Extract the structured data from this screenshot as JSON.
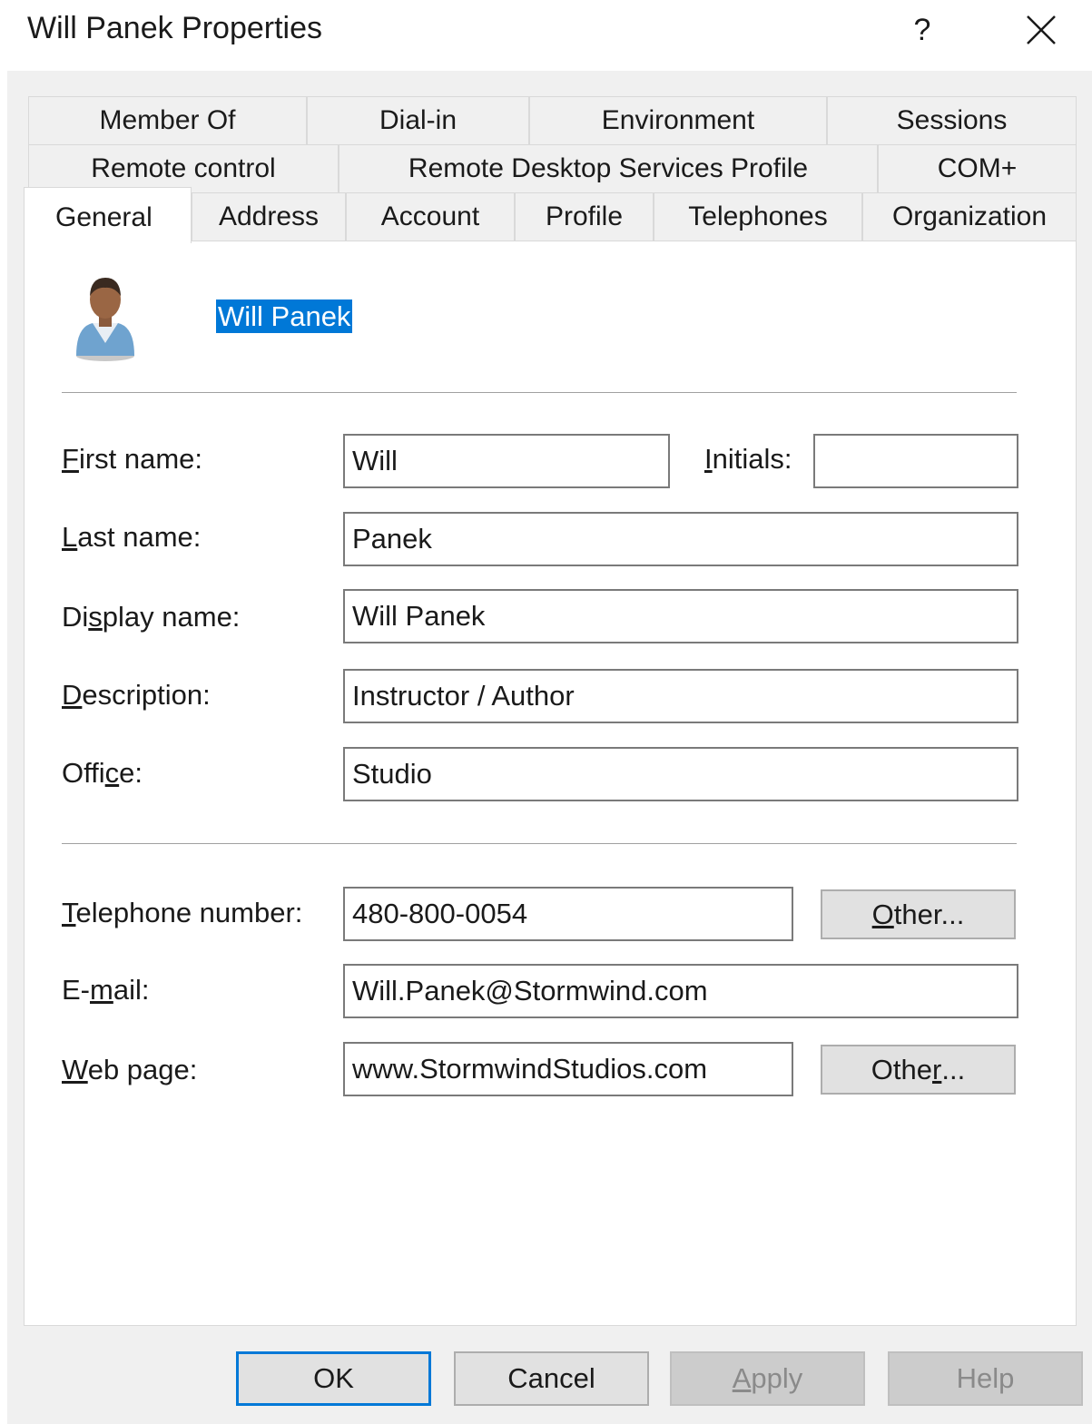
{
  "window": {
    "title": "Will Panek Properties",
    "help_glyph": "?",
    "close_glyph": "✕"
  },
  "tabs": {
    "row1": [
      "Member Of",
      "Dial-in",
      "Environment",
      "Sessions"
    ],
    "row2": [
      "Remote control",
      "Remote Desktop Services Profile",
      "COM+"
    ],
    "row3": [
      "General",
      "Address",
      "Account",
      "Profile",
      "Telephones",
      "Organization"
    ],
    "active": "General"
  },
  "general": {
    "display_name_header": "Will Panek",
    "labels": {
      "first_name": {
        "accel": "F",
        "rest": "irst name:"
      },
      "initials": {
        "accel": "I",
        "rest": "nitials:"
      },
      "last_name": {
        "accel": "L",
        "rest": "ast name:"
      },
      "display_name": {
        "pre": "Di",
        "accel": "s",
        "rest": "play name:"
      },
      "description": {
        "accel": "D",
        "rest": "escription:"
      },
      "office": {
        "pre": "Offi",
        "accel": "c",
        "rest": "e:"
      },
      "telephone": {
        "accel": "T",
        "rest": "elephone number:"
      },
      "email": {
        "pre": "E-",
        "accel": "m",
        "rest": "ail:"
      },
      "web_page": {
        "accel": "W",
        "rest": "eb page:"
      }
    },
    "values": {
      "first_name": "Will",
      "initials": "",
      "last_name": "Panek",
      "display_name": "Will Panek",
      "description": "Instructor / Author",
      "office": "Studio",
      "telephone": "480-800-0054",
      "email": "Will.Panek@Stormwind.com",
      "web_page": "www.StormwindStudios.com"
    },
    "other_phone": {
      "accel": "O",
      "rest": "ther..."
    },
    "other_web": {
      "pre": "Othe",
      "accel": "r",
      "rest": "..."
    }
  },
  "footer": {
    "ok": "OK",
    "cancel": "Cancel",
    "apply": {
      "accel": "A",
      "rest": "pply"
    },
    "help": "Help"
  },
  "colors": {
    "selection": "#0078d7",
    "dialog_bg": "#f0f0f0",
    "default_button_border": "#0078d7"
  }
}
